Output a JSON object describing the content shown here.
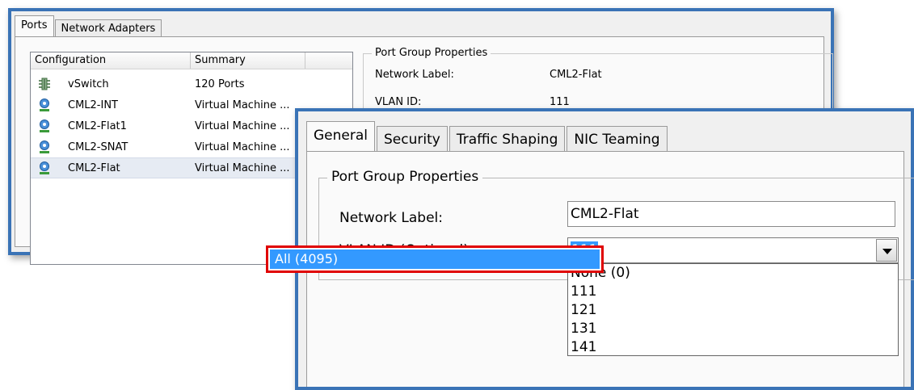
{
  "back_window": {
    "tabs": [
      {
        "label": "Ports",
        "active": true
      },
      {
        "label": "Network Adapters",
        "active": false
      }
    ],
    "list": {
      "columns": [
        "Configuration",
        "Summary",
        ""
      ],
      "rows": [
        {
          "icon": "vswitch-icon",
          "name": "vSwitch",
          "summary": "120 Ports",
          "selected": false
        },
        {
          "icon": "port-group-icon",
          "name": "CML2-INT",
          "summary": "Virtual Machine ...",
          "selected": false
        },
        {
          "icon": "port-group-icon",
          "name": "CML2-Flat1",
          "summary": "Virtual Machine ...",
          "selected": false
        },
        {
          "icon": "port-group-icon",
          "name": "CML2-SNAT",
          "summary": "Virtual Machine ...",
          "selected": false
        },
        {
          "icon": "port-group-icon",
          "name": "CML2-Flat",
          "summary": "Virtual Machine ...",
          "selected": true
        }
      ]
    },
    "port_group_properties": {
      "legend": "Port Group Properties",
      "network_label_label": "Network Label:",
      "network_label_value": "CML2-Flat",
      "vlan_id_label": "VLAN ID:",
      "vlan_id_value": "111"
    }
  },
  "dialog": {
    "tabs": [
      {
        "label": "General",
        "active": true
      },
      {
        "label": "Security",
        "active": false
      },
      {
        "label": "Traffic Shaping",
        "active": false
      },
      {
        "label": "NIC Teaming",
        "active": false
      }
    ],
    "group_legend": "Port Group Properties",
    "network_label": {
      "label": "Network Label:",
      "value": "CML2-Flat"
    },
    "vlan_id": {
      "label": "VLAN ID (Optional):",
      "selected": "111",
      "options": [
        "None (0)",
        "111",
        "121",
        "131",
        "141"
      ],
      "highlighted_option": "All (4095)"
    }
  },
  "colors": {
    "window_border": "#3a73b6",
    "selection": "#3399ff",
    "highlight_box": "#e00000"
  }
}
